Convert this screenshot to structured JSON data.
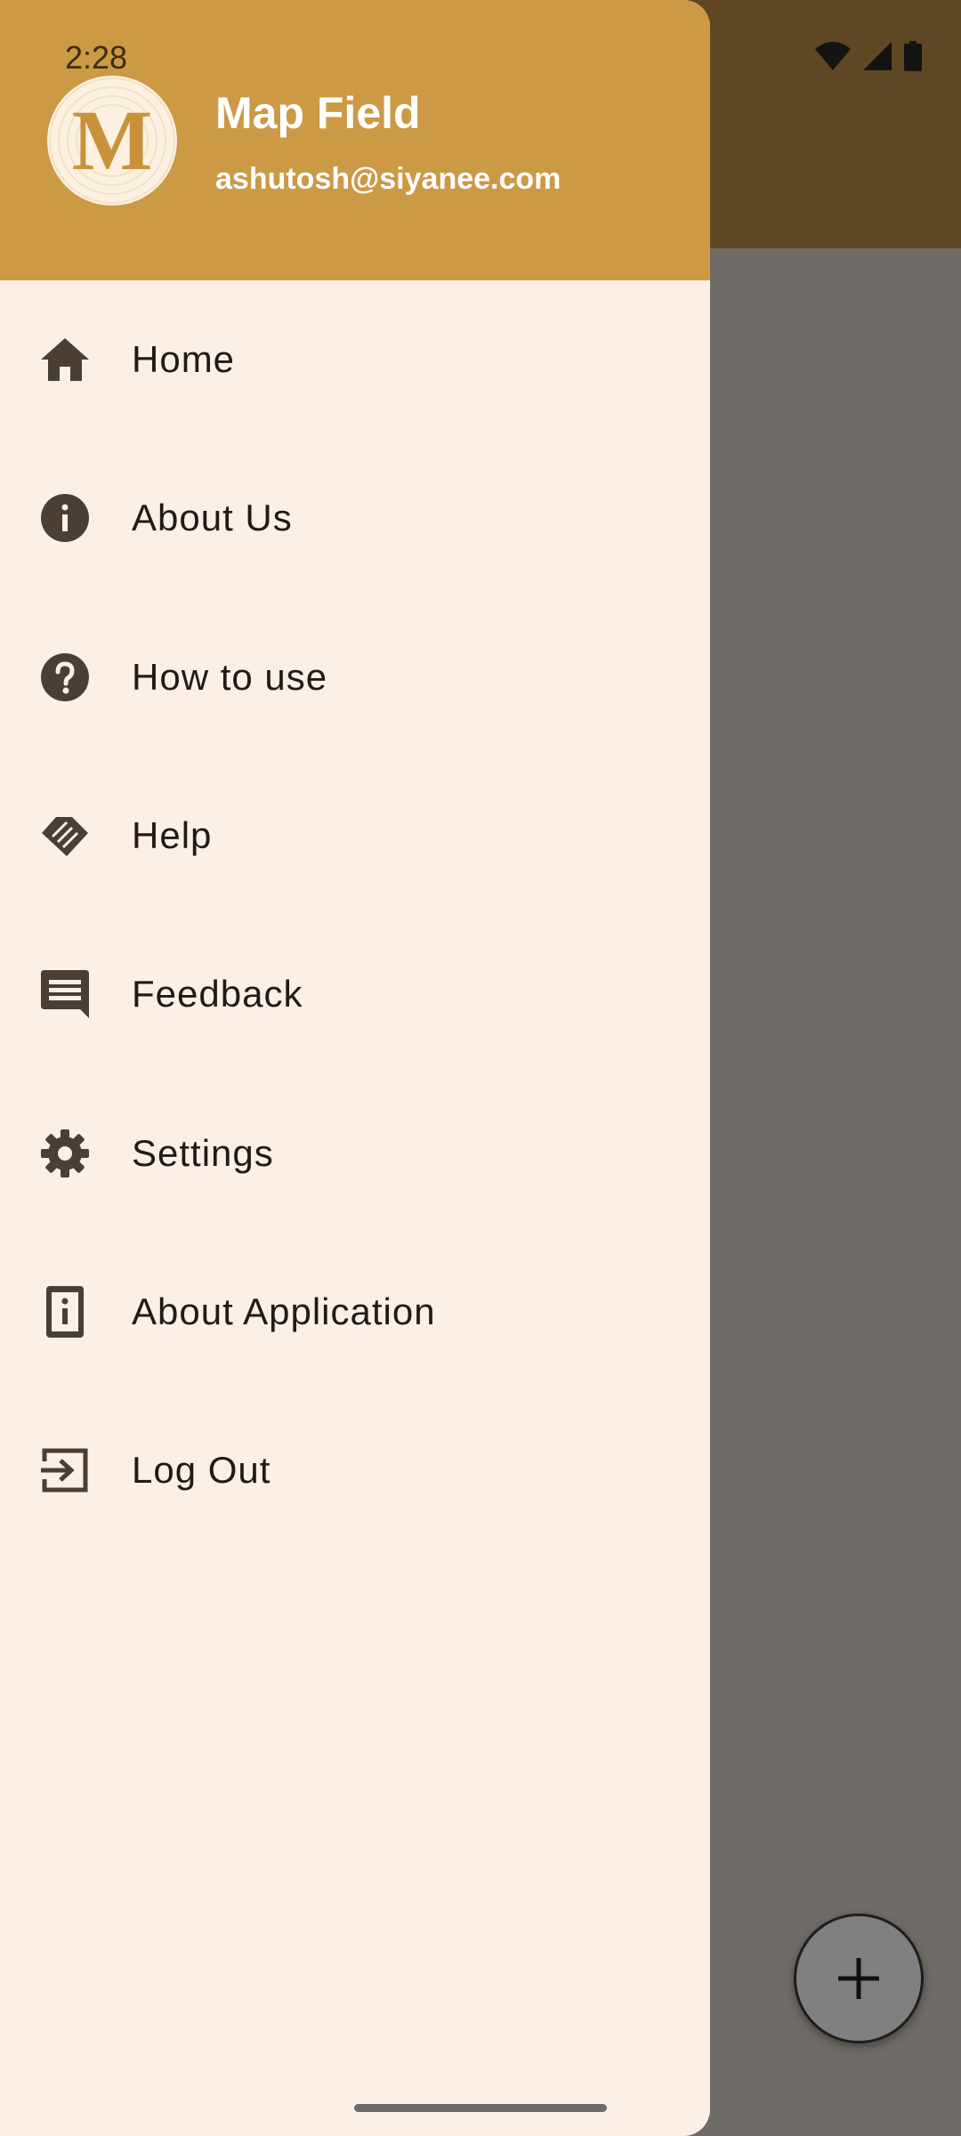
{
  "status_bar": {
    "time": "2:28"
  },
  "drawer": {
    "header": {
      "avatar_letter": "M",
      "app_name": "Map Field",
      "email": "ashutosh@siyanee.com"
    },
    "items": [
      {
        "label": "Home",
        "icon": "home-icon"
      },
      {
        "label": "About Us",
        "icon": "info-icon"
      },
      {
        "label": "How to use",
        "icon": "help-circle-icon"
      },
      {
        "label": "Help",
        "icon": "handshake-icon"
      },
      {
        "label": "Feedback",
        "icon": "feedback-icon"
      },
      {
        "label": "Settings",
        "icon": "gear-icon"
      },
      {
        "label": "About Application",
        "icon": "app-info-icon"
      },
      {
        "label": "Log Out",
        "icon": "logout-icon"
      }
    ]
  },
  "fab": {
    "icon": "plus-icon"
  },
  "colors": {
    "header": "#cc9945",
    "drawer_bg": "#fcf0e6",
    "app_bar": "#5e4722",
    "scrim_bg": "#6f6b66",
    "icon": "#4a3f36"
  }
}
